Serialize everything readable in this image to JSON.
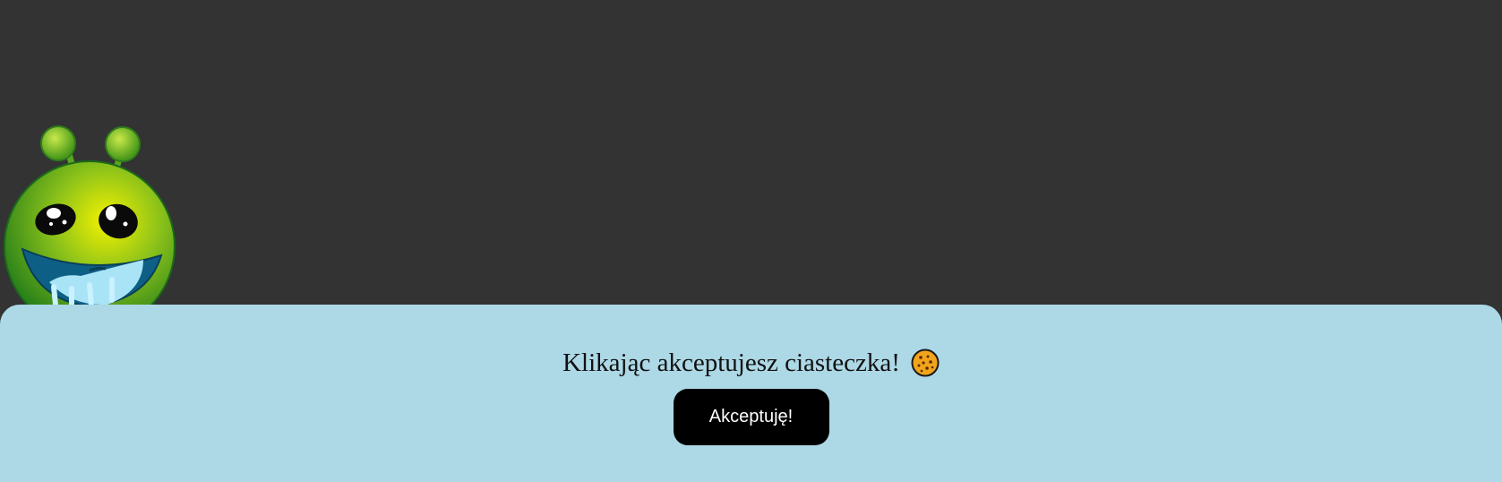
{
  "background_color": "#333333",
  "mascot": {
    "icon": "green-alien-smiley-icon"
  },
  "cookie_banner": {
    "background_color": "#add8e6",
    "message": "Klikając akceptujesz ciasteczka!",
    "cookie_icon": "cookie-icon",
    "accept_button_label": "Akceptuję!",
    "accept_button_color": "#000000"
  }
}
